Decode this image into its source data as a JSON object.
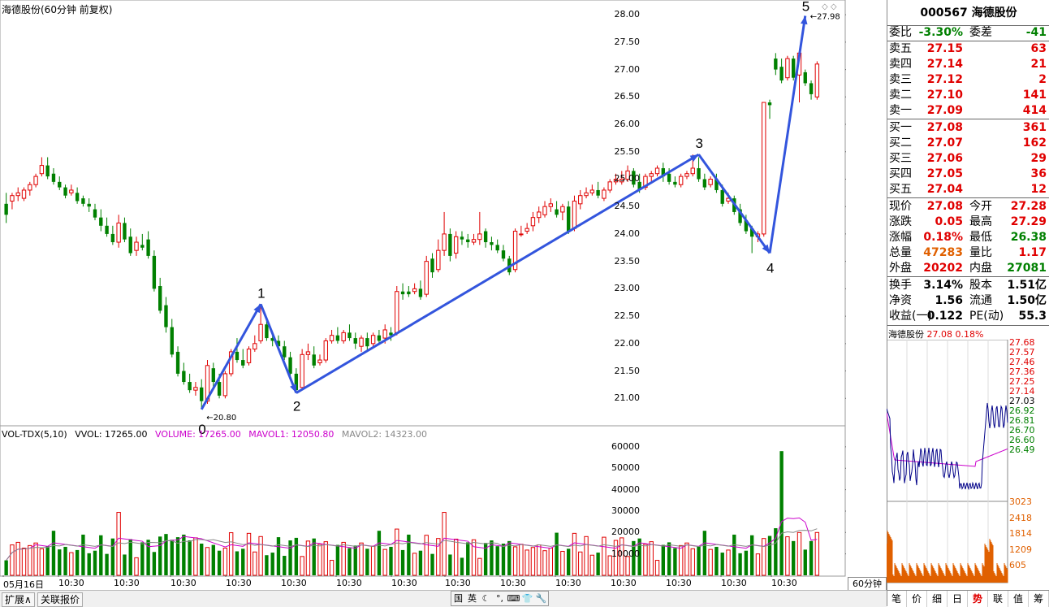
{
  "window": {
    "title": "海德股份(60分钟 前复权)"
  },
  "main_chart": {
    "y_axis": [
      "28.00",
      "27.50",
      "27.00",
      "26.50",
      "26.00",
      "25.50",
      "25.00",
      "24.50",
      "24.00",
      "23.50",
      "23.00",
      "22.50",
      "22.00",
      "21.50",
      "21.00"
    ],
    "ymin": 20.5,
    "ymax": 28.15,
    "low_label": "20.80",
    "high_label": "27.98",
    "wave_labels": [
      "0",
      "1",
      "2",
      "3",
      "4",
      "5"
    ],
    "wave_prices": [
      20.8,
      22.72,
      21.1,
      25.45,
      23.65,
      27.98
    ],
    "candles": [
      [
        24.55,
        24.75,
        24.35,
        24.2
      ],
      [
        24.6,
        24.75,
        24.7,
        24.45
      ],
      [
        24.7,
        24.85,
        24.75,
        24.6
      ],
      [
        24.65,
        24.85,
        24.8,
        24.6
      ],
      [
        24.8,
        24.95,
        24.9,
        24.7
      ],
      [
        24.9,
        25.1,
        25.05,
        24.85
      ],
      [
        25.1,
        25.4,
        25.25,
        25.05
      ],
      [
        25.25,
        25.4,
        25.05,
        25.0
      ],
      [
        25.1,
        25.2,
        24.95,
        24.9
      ],
      [
        24.95,
        25.05,
        24.85,
        24.8
      ],
      [
        24.85,
        24.9,
        24.7,
        24.65
      ],
      [
        24.75,
        24.9,
        24.8,
        24.7
      ],
      [
        24.75,
        24.85,
        24.6,
        24.55
      ],
      [
        24.65,
        24.7,
        24.55,
        24.5
      ],
      [
        24.55,
        24.65,
        24.5,
        24.4
      ],
      [
        24.45,
        24.55,
        24.3,
        24.25
      ],
      [
        24.3,
        24.45,
        24.15,
        24.05
      ],
      [
        24.15,
        24.3,
        24.0,
        23.95
      ],
      [
        24.0,
        24.15,
        23.85,
        23.8
      ],
      [
        23.85,
        24.35,
        24.2,
        23.75
      ],
      [
        24.2,
        24.3,
        23.9,
        23.85
      ],
      [
        23.95,
        24.1,
        23.65,
        23.6
      ],
      [
        23.7,
        23.95,
        23.85,
        23.6
      ],
      [
        23.8,
        24.0,
        23.75,
        23.7
      ],
      [
        23.9,
        24.05,
        23.6,
        23.55
      ],
      [
        23.6,
        23.7,
        23.0,
        22.95
      ],
      [
        23.05,
        23.2,
        22.6,
        22.55
      ],
      [
        22.7,
        22.85,
        22.3,
        22.2
      ],
      [
        22.3,
        22.45,
        21.8,
        21.75
      ],
      [
        21.85,
        21.95,
        21.45,
        21.4
      ],
      [
        21.5,
        21.65,
        21.3,
        21.25
      ],
      [
        21.3,
        21.45,
        21.15,
        21.1
      ],
      [
        21.15,
        21.3,
        21.2,
        21.05
      ],
      [
        21.2,
        21.35,
        20.95,
        20.8
      ],
      [
        20.95,
        21.7,
        21.6,
        20.9
      ],
      [
        21.55,
        21.65,
        21.3,
        21.2
      ],
      [
        21.3,
        21.45,
        21.05,
        21.0
      ],
      [
        21.05,
        21.5,
        21.45,
        21.0
      ],
      [
        21.45,
        21.9,
        21.85,
        21.4
      ],
      [
        21.85,
        22.1,
        21.7,
        21.65
      ],
      [
        21.7,
        21.9,
        21.6,
        21.55
      ],
      [
        21.65,
        21.95,
        21.9,
        21.6
      ],
      [
        21.9,
        22.15,
        22.0,
        21.85
      ],
      [
        22.05,
        22.72,
        22.35,
        22.0
      ],
      [
        22.35,
        22.45,
        22.1,
        22.05
      ],
      [
        22.1,
        22.2,
        22.05,
        21.95
      ],
      [
        22.05,
        22.15,
        21.95,
        21.9
      ],
      [
        21.95,
        22.05,
        21.75,
        21.7
      ],
      [
        21.75,
        21.85,
        21.45,
        21.4
      ],
      [
        21.45,
        21.55,
        21.15,
        21.1
      ],
      [
        21.2,
        21.9,
        21.8,
        21.15
      ],
      [
        21.8,
        22.0,
        21.85,
        21.7
      ],
      [
        21.8,
        21.95,
        21.6,
        21.55
      ],
      [
        21.65,
        21.8,
        21.7,
        21.6
      ],
      [
        21.7,
        22.1,
        22.05,
        21.65
      ],
      [
        22.05,
        22.25,
        22.15,
        22.0
      ],
      [
        22.15,
        22.3,
        22.05,
        22.0
      ],
      [
        22.05,
        22.25,
        22.2,
        22.0
      ],
      [
        22.2,
        22.35,
        22.1,
        22.05
      ],
      [
        22.1,
        22.2,
        22.0,
        21.9
      ],
      [
        21.95,
        22.15,
        22.1,
        21.85
      ],
      [
        22.1,
        22.2,
        21.95,
        21.85
      ],
      [
        22.0,
        22.2,
        22.15,
        21.95
      ],
      [
        22.15,
        22.25,
        22.05,
        22.0
      ],
      [
        22.1,
        22.35,
        22.25,
        22.0
      ],
      [
        22.2,
        22.3,
        22.15,
        22.05
      ],
      [
        22.2,
        23.05,
        22.95,
        22.15
      ],
      [
        22.95,
        23.1,
        22.9,
        22.8
      ],
      [
        22.95,
        23.05,
        22.9,
        22.85
      ],
      [
        22.95,
        23.1,
        23.0,
        22.9
      ],
      [
        23.0,
        23.15,
        22.85,
        22.8
      ],
      [
        22.9,
        23.6,
        23.5,
        22.85
      ],
      [
        23.55,
        23.65,
        23.3,
        23.2
      ],
      [
        23.35,
        23.9,
        23.7,
        23.3
      ],
      [
        23.7,
        24.4,
        24.0,
        23.6
      ],
      [
        24.0,
        24.1,
        23.6,
        23.5
      ],
      [
        23.65,
        24.05,
        23.95,
        23.55
      ],
      [
        23.95,
        24.05,
        23.9,
        23.8
      ],
      [
        23.9,
        24.0,
        23.85,
        23.75
      ],
      [
        23.85,
        24.0,
        23.9,
        23.8
      ],
      [
        23.9,
        24.4,
        24.0,
        23.8
      ],
      [
        24.05,
        24.1,
        23.85,
        23.75
      ],
      [
        23.85,
        23.95,
        23.8,
        23.7
      ],
      [
        23.8,
        23.9,
        23.7,
        23.65
      ],
      [
        23.7,
        23.8,
        23.55,
        23.5
      ],
      [
        23.55,
        23.6,
        23.3,
        23.25
      ],
      [
        23.35,
        24.1,
        24.05,
        23.3
      ],
      [
        24.0,
        24.15,
        24.0,
        23.95
      ],
      [
        24.05,
        24.2,
        24.1,
        24.0
      ],
      [
        24.15,
        24.4,
        24.3,
        24.05
      ],
      [
        24.3,
        24.5,
        24.4,
        24.2
      ],
      [
        24.35,
        24.6,
        24.5,
        24.3
      ],
      [
        24.5,
        24.65,
        24.55,
        24.4
      ],
      [
        24.45,
        24.6,
        24.35,
        24.3
      ],
      [
        24.4,
        24.55,
        24.5,
        24.25
      ],
      [
        24.5,
        24.6,
        24.05,
        24.0
      ],
      [
        24.1,
        24.7,
        24.6,
        24.05
      ],
      [
        24.55,
        24.8,
        24.7,
        24.45
      ],
      [
        24.7,
        24.85,
        24.75,
        24.65
      ],
      [
        24.75,
        24.9,
        24.8,
        24.7
      ],
      [
        24.8,
        24.95,
        24.7,
        24.65
      ],
      [
        24.65,
        24.85,
        24.8,
        24.6
      ],
      [
        24.8,
        25.0,
        24.95,
        24.75
      ],
      [
        24.95,
        25.1,
        25.0,
        24.9
      ],
      [
        24.95,
        25.15,
        25.0,
        24.9
      ],
      [
        25.0,
        25.25,
        25.15,
        24.95
      ],
      [
        25.15,
        25.2,
        24.9,
        24.85
      ],
      [
        24.95,
        25.1,
        24.8,
        24.75
      ],
      [
        24.85,
        25.1,
        25.05,
        24.8
      ],
      [
        25.05,
        25.15,
        25.1,
        24.95
      ],
      [
        25.1,
        25.25,
        25.2,
        25.05
      ],
      [
        25.2,
        25.3,
        25.05,
        24.95
      ],
      [
        25.1,
        25.2,
        24.95,
        24.9
      ],
      [
        24.95,
        25.05,
        24.9,
        24.85
      ],
      [
        24.9,
        25.1,
        25.05,
        24.85
      ],
      [
        25.05,
        25.15,
        25.1,
        25.0
      ],
      [
        25.1,
        25.45,
        25.2,
        25.05
      ],
      [
        25.2,
        25.4,
        25.0,
        24.95
      ],
      [
        25.0,
        25.1,
        24.85,
        24.8
      ],
      [
        24.9,
        25.05,
        25.0,
        24.85
      ],
      [
        25.0,
        25.1,
        24.8,
        24.75
      ],
      [
        24.8,
        24.9,
        24.55,
        24.5
      ],
      [
        24.6,
        24.75,
        24.65,
        24.55
      ],
      [
        24.65,
        24.7,
        24.4,
        24.35
      ],
      [
        24.45,
        24.55,
        24.2,
        24.15
      ],
      [
        24.25,
        24.35,
        24.05,
        24.0
      ],
      [
        24.1,
        24.15,
        23.95,
        23.65
      ],
      [
        23.95,
        24.05,
        24.0,
        23.85
      ],
      [
        24.0,
        26.4,
        26.4,
        23.95
      ],
      [
        26.4,
        26.45,
        26.35,
        26.1
      ],
      [
        27.2,
        27.3,
        27.0,
        26.9
      ],
      [
        27.05,
        27.2,
        26.8,
        26.75
      ],
      [
        26.85,
        27.25,
        27.2,
        26.8
      ],
      [
        27.2,
        27.25,
        26.85,
        26.8
      ],
      [
        26.9,
        27.3,
        27.3,
        26.4
      ],
      [
        26.95,
        27.0,
        26.75,
        26.7
      ],
      [
        26.75,
        26.8,
        26.55,
        26.45
      ],
      [
        26.5,
        27.15,
        27.1,
        26.45
      ]
    ],
    "bar_colors": {
      "up": "#e00000",
      "down": "#008000",
      "wave": "#3355dd"
    }
  },
  "volume_panel": {
    "legend": {
      "name": "VOL-TDX(5,10)",
      "vvol": "VVOL: 17265.00",
      "volume": "VOLUME: 17265.00",
      "mavol1": "MAVOL1: 12050.80",
      "mavol2": "MAVOL2: 14323.00"
    },
    "y_axis": [
      "60000",
      "50000",
      "40000",
      "30000",
      "20000",
      "10000"
    ],
    "ymax": 63000
  },
  "time_axis": {
    "first": "05月16日",
    "repeat": "10:30",
    "period_button": "60分钟"
  },
  "quote": {
    "header": "000567 海德股份",
    "weibi": {
      "label": "委比",
      "value": "-3.30%",
      "label2": "委差",
      "value2": "-41"
    },
    "sell": [
      {
        "label": "卖五",
        "price": "27.15",
        "vol": "63"
      },
      {
        "label": "卖四",
        "price": "27.14",
        "vol": "21"
      },
      {
        "label": "卖三",
        "price": "27.12",
        "vol": "2"
      },
      {
        "label": "卖二",
        "price": "27.10",
        "vol": "141"
      },
      {
        "label": "卖一",
        "price": "27.09",
        "vol": "414"
      }
    ],
    "buy": [
      {
        "label": "买一",
        "price": "27.08",
        "vol": "361"
      },
      {
        "label": "买二",
        "price": "27.07",
        "vol": "162"
      },
      {
        "label": "买三",
        "price": "27.06",
        "vol": "29"
      },
      {
        "label": "买四",
        "price": "27.05",
        "vol": "36"
      },
      {
        "label": "买五",
        "price": "27.04",
        "vol": "12"
      }
    ],
    "stats": [
      {
        "l1": "现价",
        "v1": "27.08",
        "c1": "red",
        "l2": "今开",
        "v2": "27.28",
        "c2": "red"
      },
      {
        "l1": "涨跌",
        "v1": "0.05",
        "c1": "red",
        "l2": "最高",
        "v2": "27.29",
        "c2": "red"
      },
      {
        "l1": "涨幅",
        "v1": "0.18%",
        "c1": "red",
        "l2": "最低",
        "v2": "26.38",
        "c2": "green"
      },
      {
        "l1": "总量",
        "v1": "47283",
        "c1": "orange",
        "l2": "量比",
        "v2": "1.17",
        "c2": "red"
      },
      {
        "l1": "外盘",
        "v1": "20202",
        "c1": "red",
        "l2": "内盘",
        "v2": "27081",
        "c2": "green"
      }
    ],
    "stats2": [
      {
        "l1": "换手",
        "v1": "3.14%",
        "l2": "股本",
        "v2": "1.51亿"
      },
      {
        "l1": "净资",
        "v1": "1.56",
        "l2": "流通",
        "v2": "1.50亿"
      },
      {
        "l1": "收益(一)",
        "v1": "0.122",
        "l2": "PE(动)",
        "v2": "55.3"
      }
    ]
  },
  "mini_chart": {
    "title_name": "海德股份",
    "title_price": "27.08",
    "title_pct": "0.18%",
    "price_axis": [
      "27.68",
      "27.57",
      "27.46",
      "27.36",
      "27.25",
      "27.14",
      "27.03",
      "26.92",
      "26.81",
      "26.70",
      "26.60",
      "26.49"
    ],
    "vol_axis": [
      "3023",
      "2418",
      "1814",
      "1209",
      "605"
    ]
  },
  "bottom_tabs": [
    "笔",
    "价",
    "细",
    "日",
    "势",
    "联",
    "值",
    "筹"
  ],
  "active_tab": "势",
  "bottom_buttons": [
    "扩展∧",
    "关联报价"
  ],
  "ime_icons": [
    "国",
    "英",
    "☾",
    "°,",
    "⌨",
    "👕",
    "🔧"
  ]
}
